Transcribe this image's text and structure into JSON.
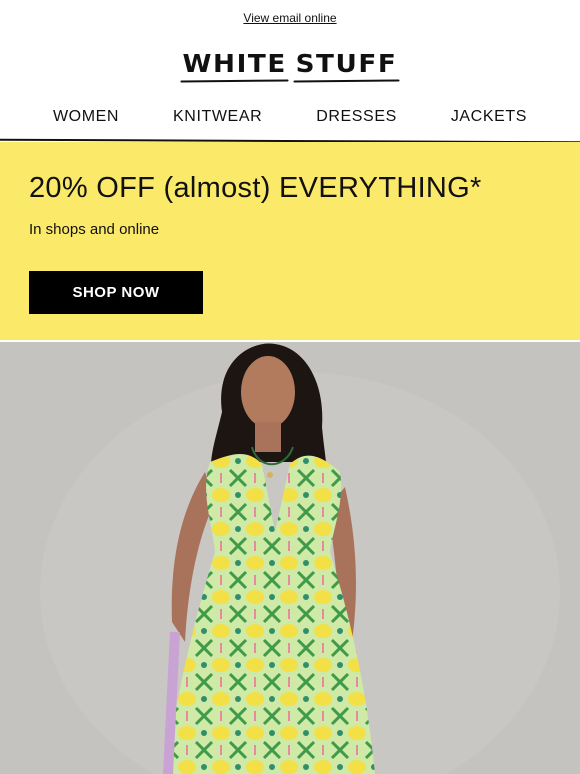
{
  "header": {
    "view_online": "View email online",
    "logo": [
      "WHITE",
      "STUFF"
    ]
  },
  "nav": {
    "items": [
      {
        "label": "WOMEN"
      },
      {
        "label": "KNITWEAR"
      },
      {
        "label": "DRESSES"
      },
      {
        "label": "JACKETS"
      }
    ]
  },
  "promo": {
    "title": "20% OFF (almost) EVERYTHING*",
    "subtitle": "In shops and online",
    "cta": "SHOP NOW",
    "background": "#fbe96a"
  },
  "hero": {
    "image_subject": "woman-in-green-yellow-lemon-print-dress"
  }
}
